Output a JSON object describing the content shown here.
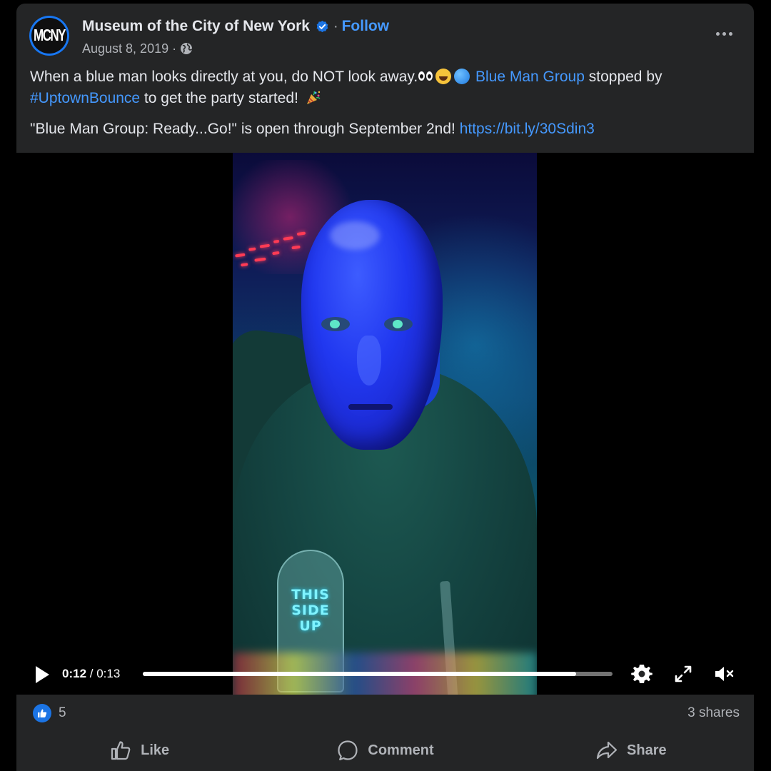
{
  "post": {
    "page_name": "Museum of the City of New York",
    "avatar_text": "MCNY",
    "follow_label": "Follow",
    "date": "August 8, 2019",
    "separator": "·",
    "audience_icon": "globe-icon",
    "more_icon": "more-options-icon"
  },
  "body": {
    "line1_text": "When a blue man looks directly at you, do NOT look away.",
    "mention": "Blue Man Group",
    "line1_after": " stopped by",
    "hashtag": "#UptownBounce",
    "line2_after": " to get the party started! ",
    "line3_text": "\"Blue Man Group: Ready...Go!\" is open through September 2nd! ",
    "link": "https://bit.ly/30Sdin3"
  },
  "video": {
    "overlay_text": [
      "THIS",
      "SIDE",
      "UP"
    ],
    "current_time": "0:12",
    "time_sep": " / ",
    "duration": "0:13",
    "progress": 0.923,
    "icons": [
      "play-icon",
      "settings-icon",
      "fullscreen-icon",
      "muted-icon"
    ]
  },
  "footer": {
    "reaction_count": "5",
    "shares": "3 shares",
    "actions": [
      {
        "label": "Like",
        "icon": "like-icon"
      },
      {
        "label": "Comment",
        "icon": "comment-icon"
      },
      {
        "label": "Share",
        "icon": "share-icon"
      }
    ]
  },
  "colors": {
    "card_bg": "#242526",
    "link": "#4599ff",
    "like_blue": "#1b74e4",
    "muted_text": "#b0b3b8"
  }
}
